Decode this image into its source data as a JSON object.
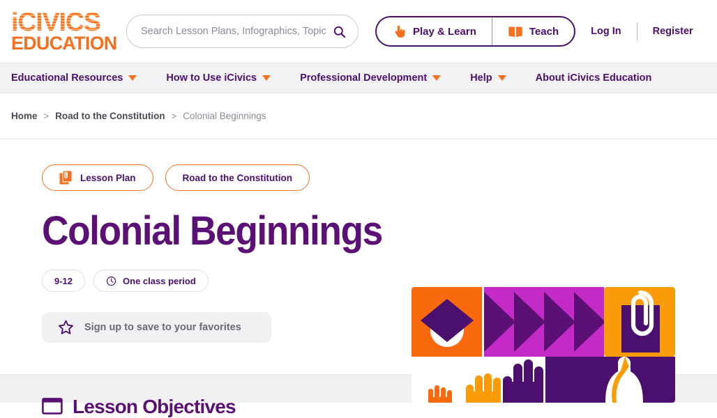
{
  "site": {
    "logo_line1": "iCIVICS",
    "logo_line2": "EDUCATION"
  },
  "search": {
    "placeholder": "Search Lesson Plans, Infographics, Topic",
    "value": "",
    "icon": "search-icon"
  },
  "header": {
    "play_learn_label": "Play & Learn",
    "play_learn_icon": "hand-click-icon",
    "teach_label": "Teach",
    "teach_icon": "open-book-icon",
    "login_label": "Log In",
    "register_label": "Register"
  },
  "nav": {
    "items": [
      {
        "label": "Educational Resources",
        "has_caret": true
      },
      {
        "label": "How to Use iCivics",
        "has_caret": true
      },
      {
        "label": "Professional Development",
        "has_caret": true
      },
      {
        "label": "Help",
        "has_caret": true
      },
      {
        "label": "About iCivics Education",
        "has_caret": false
      }
    ]
  },
  "breadcrumb": {
    "separator": ">",
    "items": [
      {
        "label": "Home",
        "current": false
      },
      {
        "label": "Road to the Constitution",
        "current": false
      },
      {
        "label": "Colonial Beginnings",
        "current": true
      }
    ]
  },
  "hero": {
    "tags": [
      {
        "label": "Lesson Plan",
        "icon": "clipboard-paperclip-icon"
      },
      {
        "label": "Road to the Constitution",
        "icon": "none"
      }
    ],
    "title": "Colonial Beginnings",
    "meta": [
      {
        "label": "9-12",
        "icon": "none"
      },
      {
        "label": "One class period",
        "icon": "clock-icon"
      }
    ],
    "favorite_button": {
      "label": "Sign up to save to your favorites",
      "icon": "star-outline-icon"
    },
    "graphic": {
      "name": "road-to-the-constitution-banner",
      "elements": [
        "graduation-cap",
        "chevron-arrows",
        "paperclip-document",
        "raised-hands",
        "capitol-dome"
      ]
    }
  },
  "bottom_section": {
    "heading": "Lesson Objectives",
    "heading_icon": "table-icon"
  },
  "colors": {
    "brand_orange": "#f4701f",
    "brand_purple": "#4b0f6e",
    "title_purple": "#5b1076",
    "magenta": "#c42ac6",
    "amber": "#f99c08",
    "nav_bg": "#f2f2f4",
    "section_bg": "#f1f1f3",
    "text_gray": "#6a6a75",
    "crumb_gray": "#8a8a95"
  }
}
